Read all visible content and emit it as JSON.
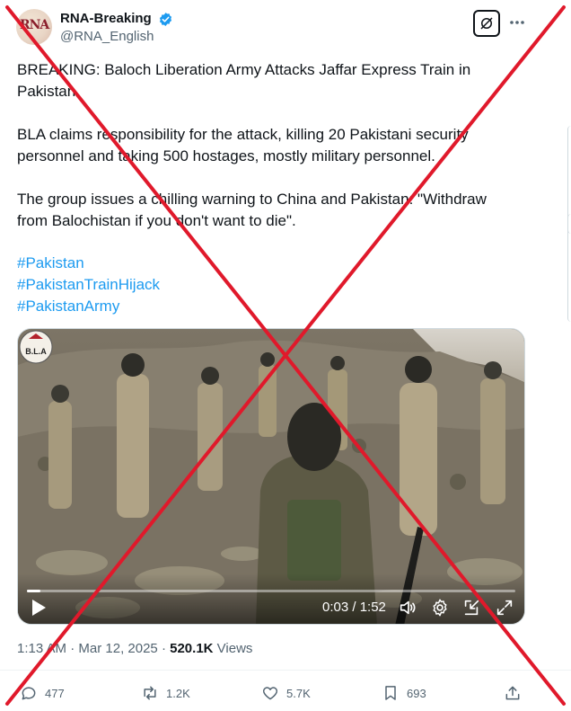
{
  "author": {
    "display_name": "RNA-Breaking",
    "handle": "@RNA_English",
    "avatar_text": "RNA"
  },
  "tweet": {
    "paragraphs": [
      "BREAKING: Baloch Liberation Army Attacks Jaffar Express Train in Pakistan.",
      "BLA claims responsibility for the attack, killing 20 Pakistani security personnel and taking 500 hostages, mostly military personnel.",
      "The group issues a chilling warning to China and Pakistan: \"Withdraw from Balochistan if you don't want to die\"."
    ],
    "hashtags": [
      "#Pakistan",
      "#PakistanTrainHijack",
      "#PakistanArmy"
    ]
  },
  "video": {
    "logo_text": "B.L.A",
    "time": "0:03 / 1:52",
    "progress": 0.027
  },
  "meta": {
    "time": "1:13 AM",
    "separator": "·",
    "date": "Mar 12, 2025",
    "views_count": "520.1K",
    "views_label": "Views"
  },
  "actions": {
    "replies": "477",
    "reposts": "1.2K",
    "likes": "5.7K",
    "bookmarks": "693"
  },
  "icons": [
    "verified-icon",
    "grok-icon",
    "more-icon",
    "play-icon",
    "volume-icon",
    "settings-icon",
    "exit-icon",
    "fullscreen-icon",
    "reply-icon",
    "repost-icon",
    "like-icon",
    "bookmark-icon",
    "share-icon"
  ],
  "colors": {
    "link": "#1d9bf0",
    "verified": "#1d9bf0",
    "overlay_cross": "#e0192b",
    "secondary_text": "#536471"
  }
}
